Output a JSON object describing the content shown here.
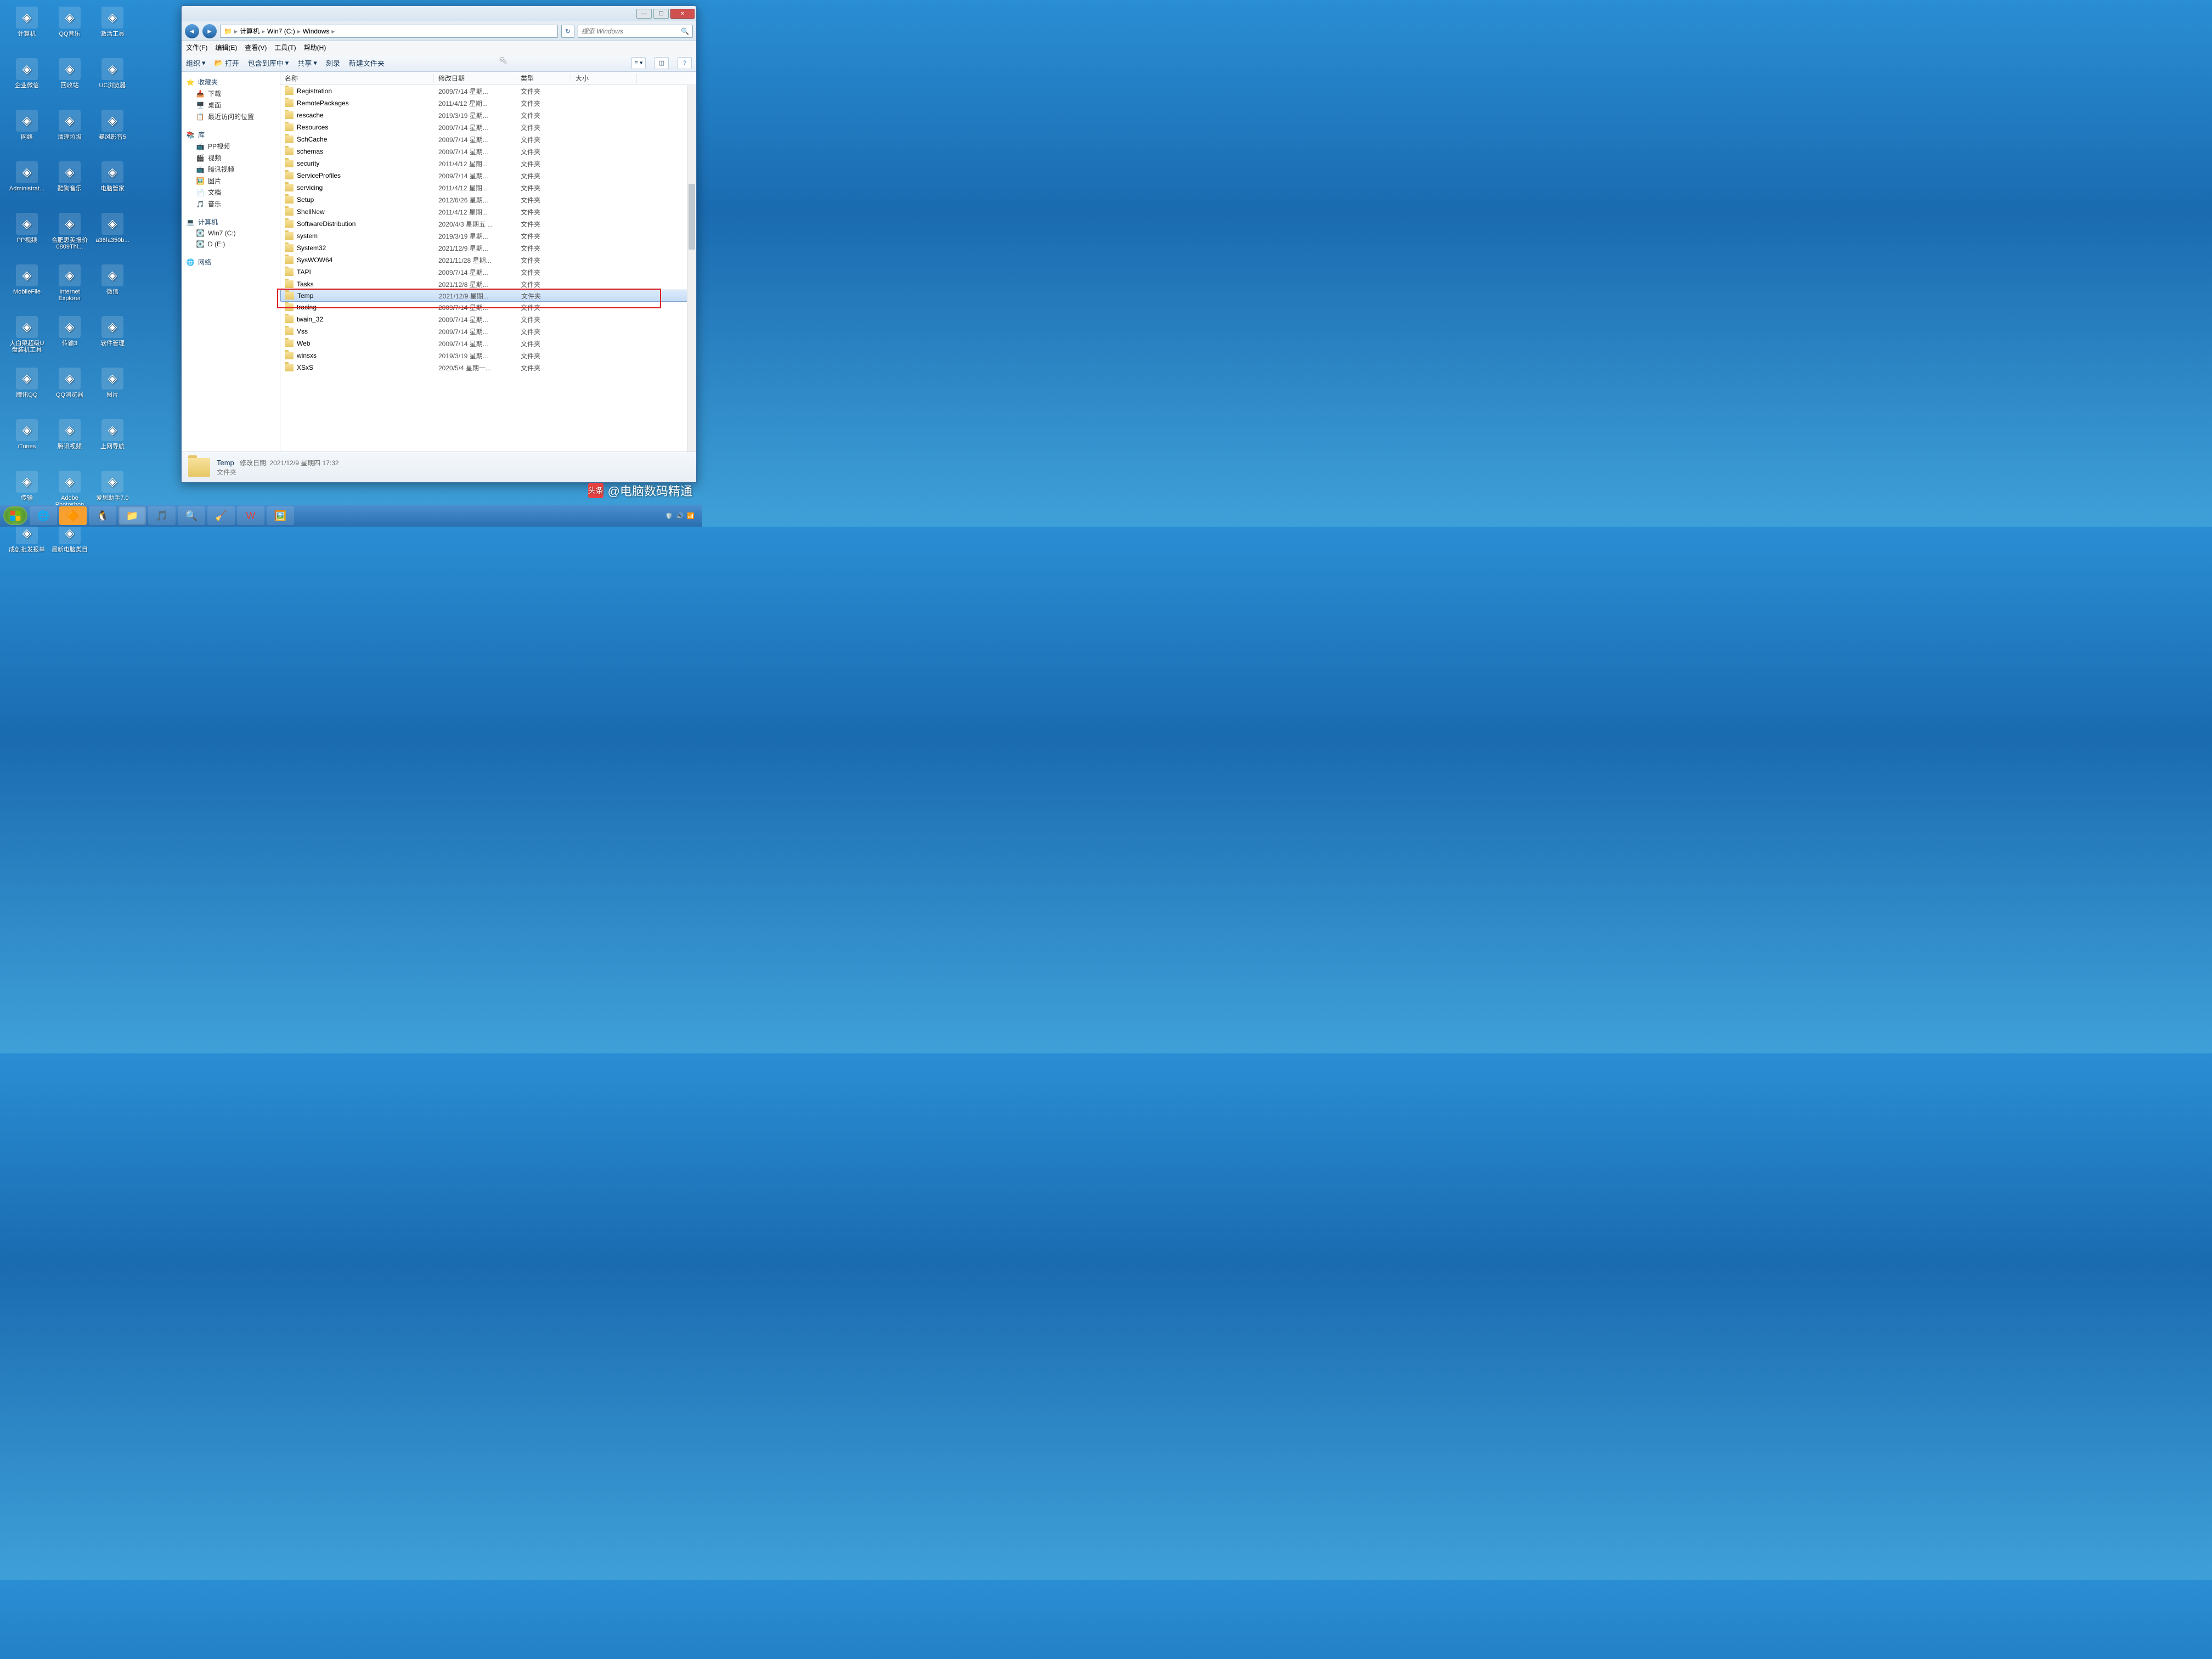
{
  "desktop_icons": [
    {
      "label": "计算机"
    },
    {
      "label": "QQ音乐"
    },
    {
      "label": "激活工具"
    },
    {
      "label": "企业微信"
    },
    {
      "label": "回收站"
    },
    {
      "label": "UC浏览器"
    },
    {
      "label": "网络"
    },
    {
      "label": "清理垃圾"
    },
    {
      "label": "暴风影音5"
    },
    {
      "label": "Administrat..."
    },
    {
      "label": "酷狗音乐"
    },
    {
      "label": "电脑管家"
    },
    {
      "label": "PP视频"
    },
    {
      "label": "合肥思美报价0809Thi..."
    },
    {
      "label": "a36fa350b..."
    },
    {
      "label": "MobileFile"
    },
    {
      "label": "Internet Explorer"
    },
    {
      "label": "微信"
    },
    {
      "label": "大白菜超级U盘装机工具"
    },
    {
      "label": "传输3"
    },
    {
      "label": "软件管理"
    },
    {
      "label": "腾讯QQ"
    },
    {
      "label": "QQ浏览器"
    },
    {
      "label": "图片"
    },
    {
      "label": "iTunes"
    },
    {
      "label": "腾讯视频"
    },
    {
      "label": "上网导航"
    },
    {
      "label": "传输"
    },
    {
      "label": "Adobe Photoshop"
    },
    {
      "label": "爱思助手7.0"
    },
    {
      "label": "成创批发报单"
    },
    {
      "label": "最新电脑类目"
    }
  ],
  "breadcrumb": {
    "root": "计算机",
    "drive": "Win7 (C:)",
    "folder": "Windows"
  },
  "search": {
    "placeholder": "搜索 Windows"
  },
  "menus": {
    "file": "文件(F)",
    "edit": "编辑(E)",
    "view": "查看(V)",
    "tools": "工具(T)",
    "help": "帮助(H)"
  },
  "toolbar": {
    "organize": "组织",
    "open": "打开",
    "include": "包含到库中",
    "share": "共享",
    "burn": "刻录",
    "newfolder": "新建文件夹"
  },
  "sidebar": {
    "favorites": {
      "hdr": "收藏夹",
      "items": [
        "下载",
        "桌面",
        "最近访问的位置"
      ]
    },
    "libraries": {
      "hdr": "库",
      "items": [
        "PP视频",
        "视频",
        "腾讯视频",
        "图片",
        "文档",
        "音乐"
      ]
    },
    "computer": {
      "hdr": "计算机",
      "items": [
        "Win7 (C:)",
        "D (E:)"
      ]
    },
    "network": {
      "hdr": "网络"
    }
  },
  "columns": {
    "name": "名称",
    "date": "修改日期",
    "type": "类型",
    "size": "大小"
  },
  "type_folder": "文件夹",
  "files": [
    {
      "name": "Registration",
      "date": "2009/7/14 星期..."
    },
    {
      "name": "RemotePackages",
      "date": "2011/4/12 星期..."
    },
    {
      "name": "rescache",
      "date": "2019/3/19 星期..."
    },
    {
      "name": "Resources",
      "date": "2009/7/14 星期..."
    },
    {
      "name": "SchCache",
      "date": "2009/7/14 星期..."
    },
    {
      "name": "schemas",
      "date": "2009/7/14 星期..."
    },
    {
      "name": "security",
      "date": "2011/4/12 星期..."
    },
    {
      "name": "ServiceProfiles",
      "date": "2009/7/14 星期..."
    },
    {
      "name": "servicing",
      "date": "2011/4/12 星期..."
    },
    {
      "name": "Setup",
      "date": "2012/6/26 星期..."
    },
    {
      "name": "ShellNew",
      "date": "2011/4/12 星期..."
    },
    {
      "name": "SoftwareDistribution",
      "date": "2020/4/3 星期五 ..."
    },
    {
      "name": "system",
      "date": "2019/3/19 星期..."
    },
    {
      "name": "System32",
      "date": "2021/12/9 星期..."
    },
    {
      "name": "SysWOW64",
      "date": "2021/11/28 星期..."
    },
    {
      "name": "TAPI",
      "date": "2009/7/14 星期..."
    },
    {
      "name": "Tasks",
      "date": "2021/12/8 星期..."
    },
    {
      "name": "Temp",
      "date": "2021/12/9 星期...",
      "selected": true
    },
    {
      "name": "tracing",
      "date": "2009/7/14 星期..."
    },
    {
      "name": "twain_32",
      "date": "2009/7/14 星期..."
    },
    {
      "name": "Vss",
      "date": "2009/7/14 星期..."
    },
    {
      "name": "Web",
      "date": "2009/7/14 星期..."
    },
    {
      "name": "winsxs",
      "date": "2019/3/19 星期..."
    },
    {
      "name": "XSxS",
      "date": "2020/5/4 星期一..."
    }
  ],
  "details": {
    "name": "Temp",
    "date_label": "修改日期:",
    "date": "2021/12/9 星期四 17:32",
    "type": "文件夹"
  },
  "watermark": {
    "prefix": "头条",
    "text": "@电脑数码精通"
  }
}
